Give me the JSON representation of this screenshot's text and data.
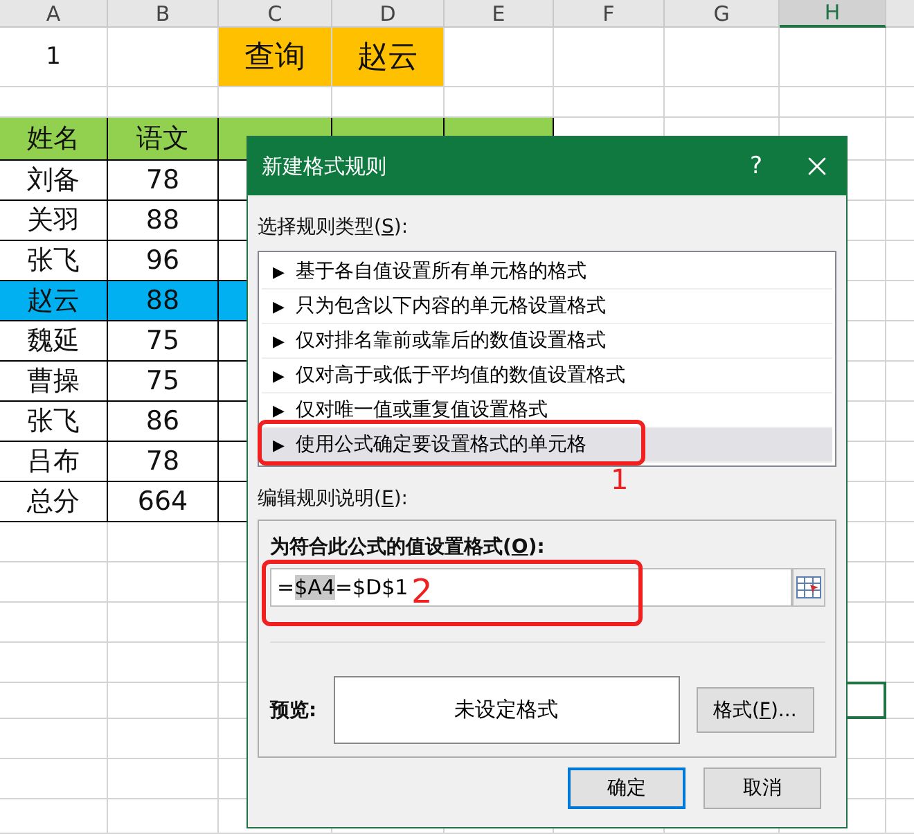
{
  "sheet": {
    "columns": [
      {
        "letter": "A",
        "selected": false
      },
      {
        "letter": "B",
        "selected": false
      },
      {
        "letter": "C",
        "selected": false
      },
      {
        "letter": "D",
        "selected": false
      },
      {
        "letter": "E",
        "selected": false
      },
      {
        "letter": "F",
        "selected": false
      },
      {
        "letter": "G",
        "selected": false
      },
      {
        "letter": "H",
        "selected": true
      }
    ],
    "rows": [
      {
        "kind": "title",
        "cells": [
          {
            "text": "1",
            "highlighted": false
          },
          {
            "highlighted": false
          },
          {
            "text": "查询",
            "highlighted": true
          },
          {
            "text": "赵云",
            "highlighted": true
          }
        ]
      },
      {
        "kind": "blank",
        "cells": []
      },
      {
        "kind": "header",
        "cells": [
          {
            "text": "姓名",
            "highlighted": false
          },
          {
            "text": "语文",
            "highlighted": false
          }
        ]
      },
      {
        "kind": "data",
        "selected": false,
        "cells": [
          {
            "text": "刘备",
            "highlighted": false
          },
          {
            "text": "78",
            "highlighted": false
          }
        ]
      },
      {
        "kind": "data",
        "selected": false,
        "cells": [
          {
            "text": "关羽",
            "highlighted": false
          },
          {
            "text": "88",
            "highlighted": false
          }
        ]
      },
      {
        "kind": "data",
        "selected": false,
        "cells": [
          {
            "text": "张飞",
            "highlighted": false
          },
          {
            "text": "96",
            "highlighted": false
          }
        ]
      },
      {
        "kind": "data",
        "selected": true,
        "cells": [
          {
            "text": "赵云",
            "highlighted": false
          },
          {
            "text": "88",
            "highlighted": false
          }
        ]
      },
      {
        "kind": "data",
        "selected": false,
        "cells": [
          {
            "text": "魏延",
            "highlighted": false
          },
          {
            "text": "75",
            "highlighted": false
          }
        ]
      },
      {
        "kind": "data",
        "selected": false,
        "cells": [
          {
            "text": "曹操",
            "highlighted": false
          },
          {
            "text": "75",
            "highlighted": false
          }
        ]
      },
      {
        "kind": "data",
        "selected": false,
        "cells": [
          {
            "text": "张飞",
            "highlighted": false
          },
          {
            "text": "86",
            "highlighted": false
          }
        ]
      },
      {
        "kind": "data",
        "selected": false,
        "cells": [
          {
            "text": "吕布",
            "highlighted": false
          },
          {
            "text": "78",
            "highlighted": false
          }
        ]
      },
      {
        "kind": "data",
        "selected": false,
        "cells": [
          {
            "text": "总分",
            "highlighted": false
          },
          {
            "text": "664",
            "highlighted": false
          }
        ]
      }
    ]
  },
  "dialog": {
    "title": "新建格式规则",
    "help": "?",
    "rule_type_label": {
      "before": "选择规则类型(",
      "key": "S",
      "after": "):"
    },
    "rule_types": [
      {
        "label": "基于各自值设置所有单元格的格式",
        "selected": false
      },
      {
        "label": "只为包含以下内容的单元格设置格式",
        "selected": false
      },
      {
        "label": "仅对排名靠前或靠后的数值设置格式",
        "selected": false
      },
      {
        "label": "仅对高于或低于平均值的数值设置格式",
        "selected": false
      },
      {
        "label": "仅对唯一值或重复值设置格式",
        "selected": false
      },
      {
        "label": "使用公式确定要设置格式的单元格",
        "selected": true
      }
    ],
    "marker": "▶",
    "description_label": {
      "before": "编辑规则说明(",
      "key": "E",
      "after": "):"
    },
    "formula_label": {
      "before": "为符合此公式的值设置格式(",
      "key": "O",
      "after": "):"
    },
    "formula": [
      {
        "text": "=",
        "selected": false
      },
      {
        "text": "$A4",
        "selected": true
      },
      {
        "text": "=$D$1",
        "selected": false
      }
    ],
    "preview_label": "预览:",
    "preview": "未设定格式",
    "format_button": {
      "before": "格式(",
      "key": "F",
      "after": ")..."
    },
    "ok": "确定",
    "cancel": "取消"
  },
  "annotations": [
    {
      "label": "1"
    },
    {
      "label": "2"
    }
  ]
}
